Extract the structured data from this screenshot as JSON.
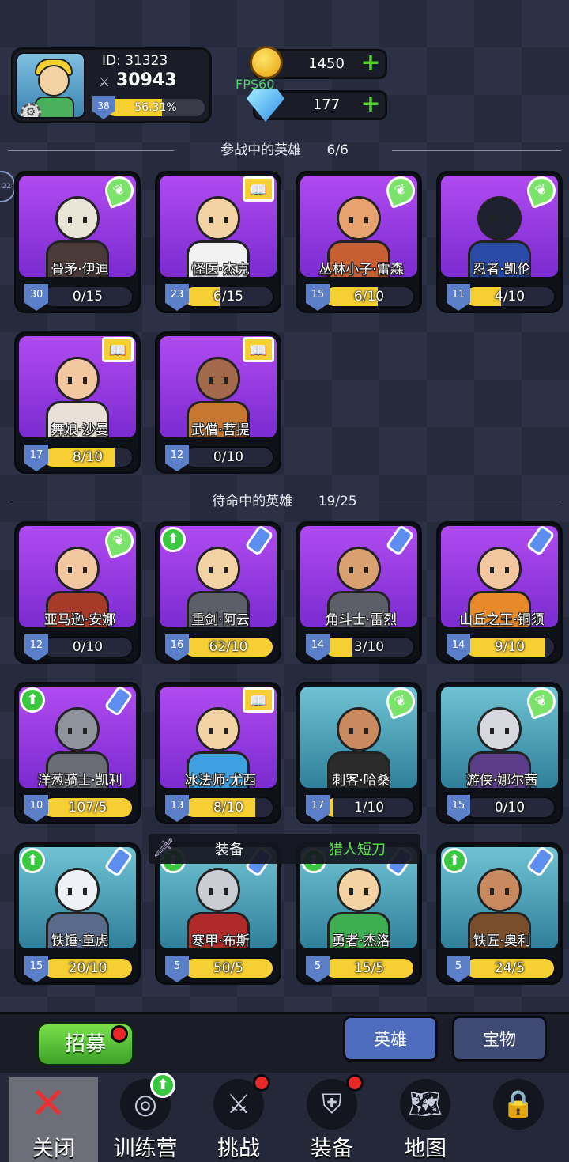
{
  "player": {
    "id_label": "ID: 31323",
    "power": "30943",
    "level": "38",
    "xp_percent_text": "56.31%",
    "xp_fraction": 0.5631
  },
  "currency": {
    "gold": "1450",
    "gems": "177",
    "fps": "FPS60"
  },
  "side_indicator": "22",
  "active_section": {
    "title": "参战中的英雄",
    "count": "6/6"
  },
  "reserve_section": {
    "title": "待命中的英雄",
    "count": "19/25"
  },
  "active_heroes": [
    {
      "name": "骨矛·伊迪",
      "level": "30",
      "progress": "0/15",
      "fill": 0,
      "badge": "leaf-icon",
      "bg": "purple",
      "skin": "#e9e4d6",
      "outfit": "#4a3a3a"
    },
    {
      "name": "怪医·杰克",
      "level": "23",
      "progress": "6/15",
      "fill": 0.4,
      "badge": "book-icon",
      "bg": "purple",
      "skin": "#f3d3a3",
      "outfit": "#f2f2f2"
    },
    {
      "name": "丛林小子·雷森",
      "level": "15",
      "progress": "6/10",
      "fill": 0.6,
      "badge": "leaf-icon",
      "bg": "purple",
      "skin": "#e8a270",
      "outfit": "#c85f32"
    },
    {
      "name": "忍者·凯伦",
      "level": "11",
      "progress": "4/10",
      "fill": 0.4,
      "badge": "leaf-icon",
      "bg": "purple",
      "skin": "#1e2130",
      "outfit": "#2a4aa8"
    },
    {
      "name": "舞娘·沙曼",
      "level": "17",
      "progress": "8/10",
      "fill": 0.8,
      "badge": "book-icon",
      "bg": "purple",
      "skin": "#f3c8a0",
      "outfit": "#e8e0d6"
    },
    {
      "name": "武僧·菩提",
      "level": "12",
      "progress": "0/10",
      "fill": 0,
      "badge": "book-icon",
      "bg": "purple",
      "skin": "#a26a4a",
      "outfit": "#c8772f"
    }
  ],
  "reserve_heroes": [
    {
      "name": "亚马逊·安娜",
      "level": "12",
      "progress": "0/10",
      "fill": 0,
      "badge": "leaf-icon",
      "upgrade": false,
      "bg": "purple",
      "skin": "#f3c8a0",
      "outfit": "#a83a2a"
    },
    {
      "name": "重剑·阿云",
      "level": "16",
      "progress": "62/10",
      "fill": 1,
      "badge": "potion-icon",
      "upgrade": true,
      "bg": "purple",
      "skin": "#f3d3a3",
      "outfit": "#5c5f68"
    },
    {
      "name": "角斗士·雷烈",
      "level": "14",
      "progress": "3/10",
      "fill": 0.3,
      "badge": "potion-icon",
      "upgrade": false,
      "bg": "purple",
      "skin": "#d9a070",
      "outfit": "#5c5f68"
    },
    {
      "name": "山丘之王·铜须",
      "level": "14",
      "progress": "9/10",
      "fill": 0.9,
      "badge": "potion-icon",
      "upgrade": false,
      "bg": "purple",
      "skin": "#f3c8a0",
      "outfit": "#e88a2a"
    },
    {
      "name": "洋葱骑士·凯利",
      "level": "10",
      "progress": "107/5",
      "fill": 1,
      "badge": "potion-icon",
      "upgrade": true,
      "bg": "purple",
      "skin": "#8e939c",
      "outfit": "#6a6d75"
    },
    {
      "name": "冰法师·尤西",
      "level": "13",
      "progress": "8/10",
      "fill": 0.8,
      "badge": "book-icon",
      "upgrade": false,
      "bg": "purple",
      "skin": "#f3d3a3",
      "outfit": "#3fa0e0"
    },
    {
      "name": "刺客·哈桑",
      "level": "17",
      "progress": "1/10",
      "fill": 0.1,
      "badge": "leaf-icon",
      "upgrade": false,
      "bg": "teal",
      "skin": "#c98a60",
      "outfit": "#2b2b2b"
    },
    {
      "name": "游侠·娜尔茜",
      "level": "15",
      "progress": "0/10",
      "fill": 0,
      "badge": "leaf-icon",
      "upgrade": false,
      "bg": "teal",
      "skin": "#d8d8e0",
      "outfit": "#5b3d8a"
    },
    {
      "name": "铁锤·童虎",
      "level": "15",
      "progress": "20/10",
      "fill": 1,
      "badge": "potion-icon",
      "upgrade": true,
      "bg": "teal",
      "skin": "#eef2f6",
      "outfit": "#5a6a8a"
    },
    {
      "name": "寒甲·布斯",
      "level": "5",
      "progress": "50/5",
      "fill": 1,
      "badge": "potion-icon",
      "upgrade": true,
      "bg": "teal",
      "skin": "#c9ccd2",
      "outfit": "#b02a2a"
    },
    {
      "name": "勇者·杰洛",
      "level": "5",
      "progress": "15/5",
      "fill": 1,
      "badge": "potion-icon",
      "upgrade": true,
      "bg": "teal",
      "skin": "#f3d3a3",
      "outfit": "#3fae52"
    },
    {
      "name": "铁匠·奥利",
      "level": "5",
      "progress": "24/5",
      "fill": 1,
      "badge": "potion-icon",
      "upgrade": true,
      "bg": "teal",
      "skin": "#c98a60",
      "outfit": "#7a4e2a"
    }
  ],
  "tooltip": {
    "label": "装备",
    "item": "猎人短刀"
  },
  "bottom": {
    "recruit": "招募",
    "tab_heroes": "英雄",
    "tab_treasure": "宝物"
  },
  "nav": [
    {
      "label": "关闭",
      "icon": "close-icon",
      "dot": false,
      "upgrade": false
    },
    {
      "label": "训练营",
      "icon": "target-icon",
      "dot": false,
      "upgrade": true
    },
    {
      "label": "挑战",
      "icon": "sword-icon",
      "dot": true,
      "upgrade": false
    },
    {
      "label": "装备",
      "icon": "armor-icon",
      "dot": true,
      "upgrade": false
    },
    {
      "label": "地图",
      "icon": "map-icon",
      "dot": false,
      "upgrade": false
    },
    {
      "label": "",
      "icon": "lock-icon",
      "dot": false,
      "upgrade": false
    }
  ],
  "colors": {
    "background": "#262a3d",
    "progress_fill": "#f6cf33",
    "level_shield": "#5b7fc8",
    "upgrade_green": "#39c83f",
    "fps_text": "#4dd36b"
  }
}
